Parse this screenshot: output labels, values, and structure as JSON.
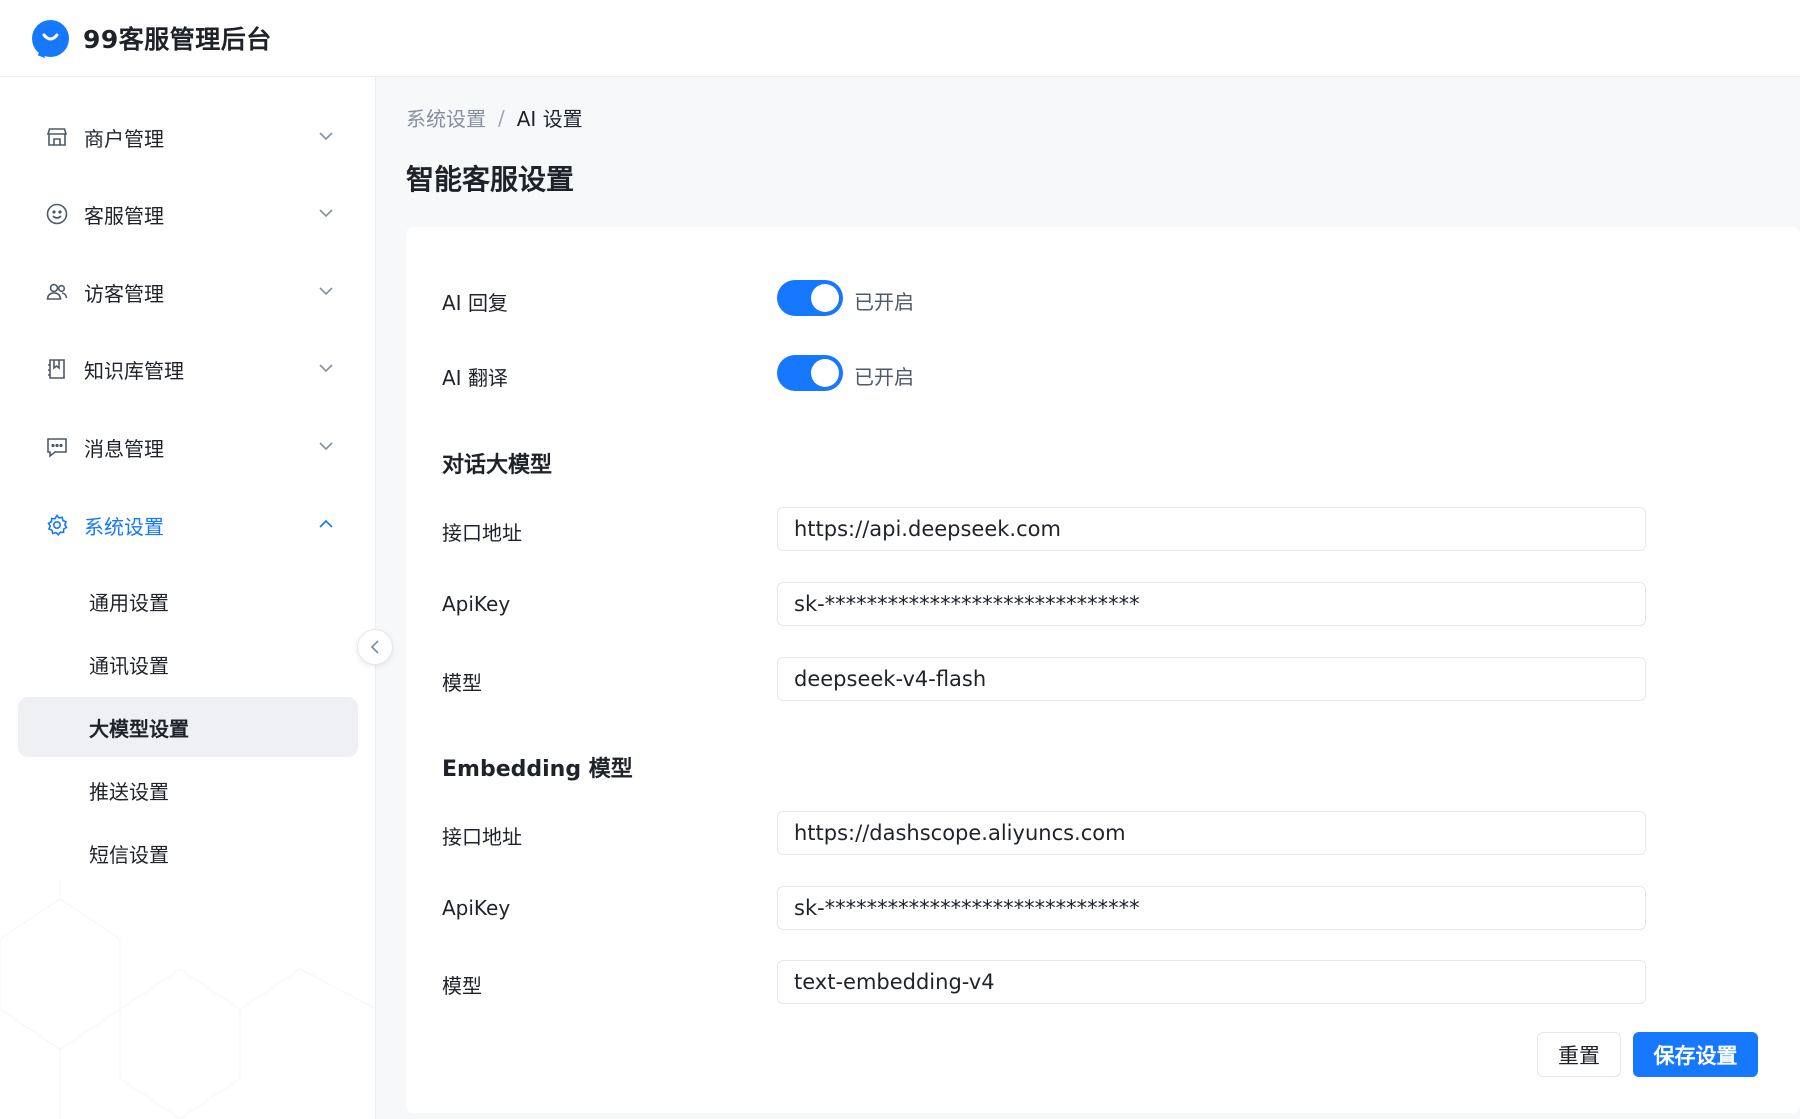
{
  "app": {
    "title": "99客服管理后台"
  },
  "sidebar": {
    "items": [
      {
        "label": "商户管理",
        "icon": "store-icon"
      },
      {
        "label": "客服管理",
        "icon": "smile-icon"
      },
      {
        "label": "访客管理",
        "icon": "users-icon"
      },
      {
        "label": "知识库管理",
        "icon": "book-icon"
      },
      {
        "label": "消息管理",
        "icon": "message-icon"
      },
      {
        "label": "系统设置",
        "icon": "gear-icon"
      }
    ],
    "sub_items": [
      {
        "label": "通用设置"
      },
      {
        "label": "通讯设置"
      },
      {
        "label": "大模型设置"
      },
      {
        "label": "推送设置"
      },
      {
        "label": "短信设置"
      }
    ]
  },
  "breadcrumb": {
    "parent": "系统设置",
    "separator": "/",
    "current": "AI 设置"
  },
  "page": {
    "title": "智能客服设置"
  },
  "form": {
    "ai_reply": {
      "label": "AI 回复",
      "status": "已开启"
    },
    "ai_translate": {
      "label": "AI 翻译",
      "status": "已开启"
    },
    "chat_model": {
      "section_title": "对话大模型",
      "endpoint_label": "接口地址",
      "endpoint_value": "https://api.deepseek.com",
      "apikey_label": "ApiKey",
      "apikey_value": "sk-******************************",
      "model_label": "模型",
      "model_value": "deepseek-v4-flash"
    },
    "embedding_model": {
      "section_title": "Embedding 模型",
      "endpoint_label": "接口地址",
      "endpoint_value": "https://dashscope.aliyuncs.com",
      "apikey_label": "ApiKey",
      "apikey_value": "sk-******************************",
      "model_label": "模型",
      "model_value": "text-embedding-v4"
    }
  },
  "actions": {
    "reset_label": "重置",
    "save_label": "保存设置"
  },
  "colors": {
    "primary": "#1677ff",
    "selected_bg": "#eef0f3"
  }
}
